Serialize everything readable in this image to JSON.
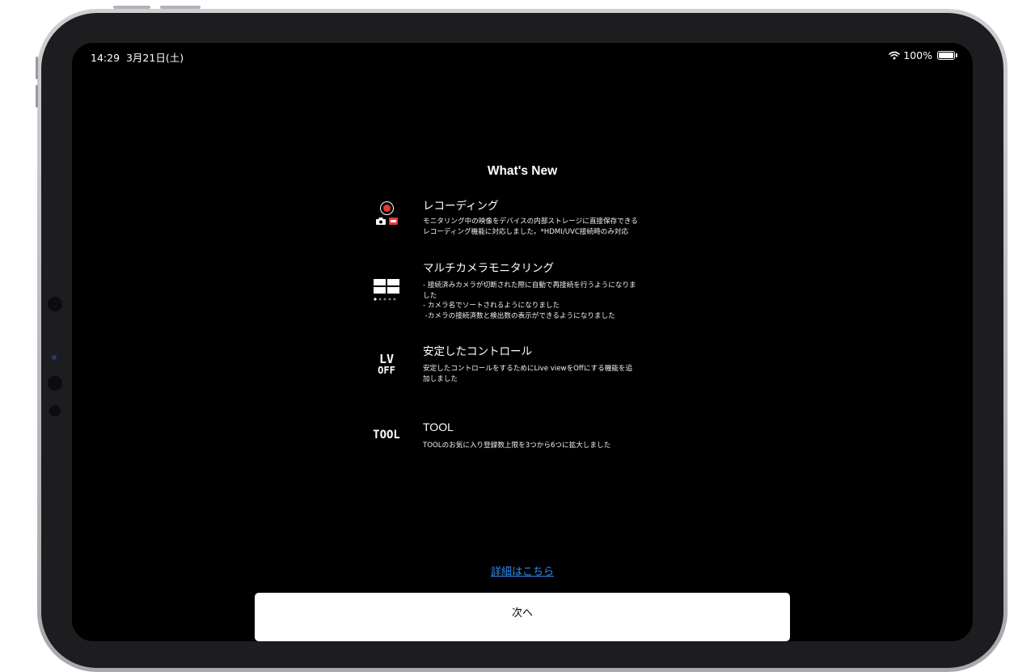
{
  "status_bar": {
    "time": "14:29",
    "date": "3月21日(土)",
    "battery": "100%",
    "icons": [
      "wifi-icon",
      "battery-icon"
    ]
  },
  "title": "What's New",
  "features": [
    {
      "icon": "record-icon",
      "title": "レコーディング",
      "description_lines": [
        "モニタリング中の映像をデバイスの内部ストレージに直接保存できる",
        "レコーディング機能に対応しました。*HDMI/UVC接続時のみ対応"
      ]
    },
    {
      "icon": "multi-camera-grid-icon",
      "title": "マルチカメラモニタリング",
      "description_lines": [
        "- 接続済みカメラが切断された際に自動で再接続を行うようになりま",
        "した",
        "- カメラ名でソートされるようになりました",
        " -カメラの接続済数と検出数の表示ができるようになりました"
      ]
    },
    {
      "icon": "live-view-off-icon",
      "icon_text": [
        "LV",
        "OFF"
      ],
      "title": "安定したコントロール",
      "description_lines": [
        "安定したコントロールをするためにLive viewをOffにする機能を追",
        "加しました"
      ]
    },
    {
      "icon": "tool-icon",
      "icon_text": [
        "TOOL"
      ],
      "title": "TOOL",
      "description_lines": [
        "TOOLのお気に入り登録数上限を3つから6つに拡大しました"
      ]
    }
  ],
  "link": "詳細はこちら",
  "next_button": "次へ",
  "colors": {
    "background": "#000000",
    "link": "#2f8bf0",
    "record_red": "#e53935",
    "button_bg": "#ffffff"
  }
}
